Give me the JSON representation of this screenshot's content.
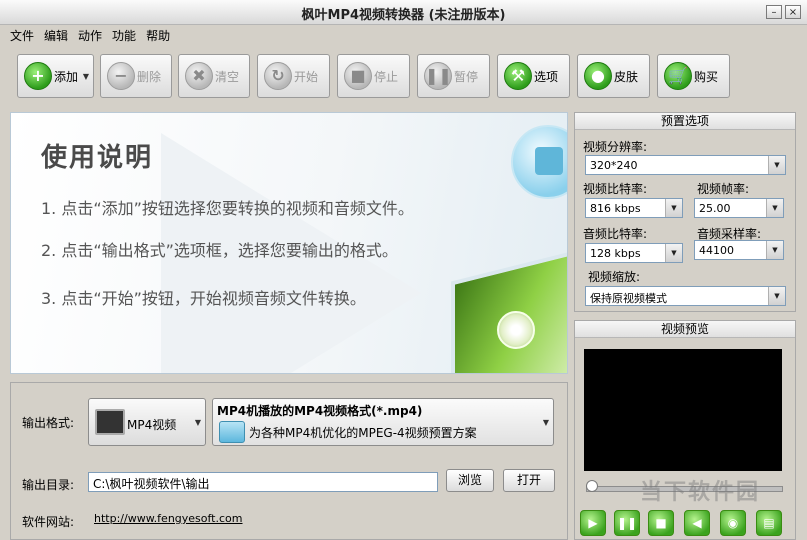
{
  "window": {
    "title": "枫叶MP4视频转换器 (未注册版本)",
    "minimize_glyph": "–",
    "close_glyph": "×"
  },
  "menu": {
    "items": [
      "文件",
      "编辑",
      "动作",
      "功能",
      "帮助"
    ]
  },
  "toolbar": {
    "buttons": [
      {
        "label": "添加",
        "icon": "plus-icon",
        "enabled": true
      },
      {
        "label": "删除",
        "icon": "minus-icon",
        "enabled": false
      },
      {
        "label": "清空",
        "icon": "clear-icon",
        "enabled": false
      },
      {
        "label": "开始",
        "icon": "refresh-icon",
        "enabled": false
      },
      {
        "label": "停止",
        "icon": "stop-icon",
        "enabled": false
      },
      {
        "label": "暂停",
        "icon": "pause-icon",
        "enabled": false
      },
      {
        "label": "选项",
        "icon": "tools-icon",
        "enabled": true
      },
      {
        "label": "皮肤",
        "icon": "apple-icon",
        "enabled": true
      },
      {
        "label": "购买",
        "icon": "cart-icon",
        "enabled": true
      }
    ]
  },
  "instructions": {
    "title": "使用说明",
    "steps": [
      "1. 点击“添加”按钮选择您要转换的视频和音频文件。",
      "2. 点击“输出格式”选项框，选择您要输出的格式。",
      "3. 点击“开始”按钮，开始视频音频文件转换。"
    ]
  },
  "output": {
    "format_label": "输出格式:",
    "format_button": "MP4视频",
    "format_title": "MP4机播放的MP4视频格式(*.mp4)",
    "format_desc": "为各种MP4机优化的MPEG-4视频预置方案",
    "dir_label": "输出目录:",
    "dir_value": "C:\\枫叶视频软件\\输出",
    "browse_label": "浏览",
    "open_label": "打开",
    "site_label": "软件网站:",
    "site_url": "http://www.fengyesoft.com"
  },
  "preset": {
    "title": "预置选项",
    "resolution_label": "视频分辨率:",
    "resolution_value": "320*240",
    "vbitrate_label": "视频比特率:",
    "vbitrate_value": "816 kbps",
    "framerate_label": "视频帧率:",
    "framerate_value": "25.00",
    "abitrate_label": "音频比特率:",
    "abitrate_value": "128 kbps",
    "samplerate_label": "音频采样率:",
    "samplerate_value": "44100",
    "scale_label": "视频缩放:",
    "scale_value": "保持原视频模式"
  },
  "preview": {
    "title": "视频预览",
    "seek_position": 0.0,
    "controls": [
      "play-icon",
      "pause-icon",
      "stop-icon",
      "volume-icon",
      "snapshot-icon",
      "folder-icon"
    ]
  },
  "watermark": "当下软件园"
}
